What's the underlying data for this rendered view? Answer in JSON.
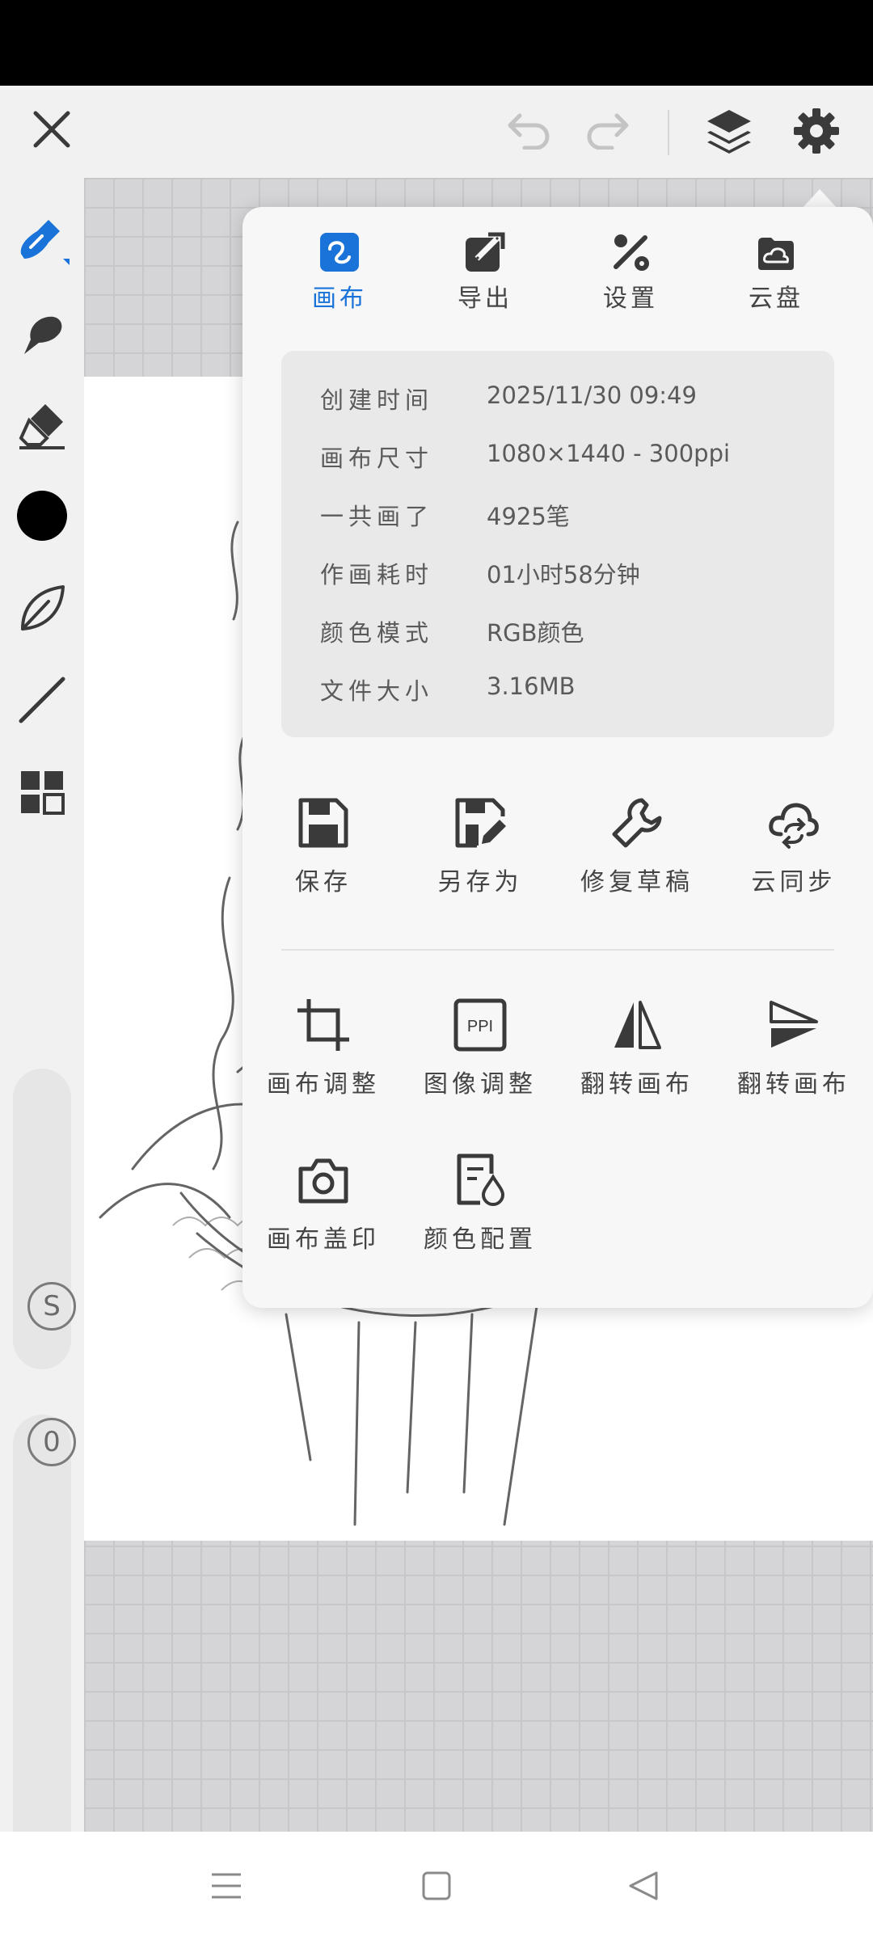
{
  "colors": {
    "accent": "#1a73d9",
    "icon": "#3a3a3a",
    "disabled": "#c4c4c4",
    "text": "#444444",
    "info_text": "#5a5a5a"
  },
  "top_bar": {
    "close_icon": "close-icon",
    "undo_icon": "undo-icon",
    "redo_icon": "redo-icon",
    "layers_icon": "layers-icon",
    "settings_icon": "gear-icon"
  },
  "left_toolbar": {
    "tools": [
      "brush-icon",
      "smudge-icon",
      "eraser-icon",
      "color-swatch",
      "leaf-brush-icon",
      "line-icon",
      "grid-menu-icon"
    ],
    "size_slider_label": "S",
    "opacity_slider_label": "0"
  },
  "popup": {
    "tabs": [
      {
        "label": "画布",
        "icon": "canvas-icon",
        "active": true
      },
      {
        "label": "导出",
        "icon": "export-icon",
        "active": false
      },
      {
        "label": "设置",
        "icon": "tools-icon",
        "active": false
      },
      {
        "label": "云盘",
        "icon": "cloud-drive-icon",
        "active": false
      }
    ],
    "info": [
      {
        "label": "创建时间",
        "value": "2025/11/30 09:49"
      },
      {
        "label": "画布尺寸",
        "value": "1080×1440 - 300ppi"
      },
      {
        "label": "一共画了",
        "value": "4925笔"
      },
      {
        "label": "作画耗时",
        "value": "01小时58分钟"
      },
      {
        "label": "颜色模式",
        "value": "RGB颜色"
      },
      {
        "label": "文件大小",
        "value": "3.16MB"
      }
    ],
    "actions_top": [
      {
        "label": "保存",
        "icon": "save-icon"
      },
      {
        "label": "另存为",
        "icon": "save-as-icon"
      },
      {
        "label": "修复草稿",
        "icon": "wrench-icon"
      },
      {
        "label": "云同步",
        "icon": "cloud-sync-icon"
      }
    ],
    "actions_bottom": [
      {
        "label": "画布调整",
        "icon": "crop-icon"
      },
      {
        "label": "图像调整",
        "icon": "ppi-icon",
        "icon_text": "PPI"
      },
      {
        "label": "翻转画布",
        "icon": "flip-horizontal-icon"
      },
      {
        "label": "翻转画布",
        "icon": "flip-vertical-icon"
      },
      {
        "label": "画布盖印",
        "icon": "camera-icon"
      },
      {
        "label": "颜色配置",
        "icon": "color-config-icon"
      }
    ]
  },
  "nav_bar": {
    "items": [
      "menu-icon",
      "home-icon",
      "back-icon"
    ]
  }
}
